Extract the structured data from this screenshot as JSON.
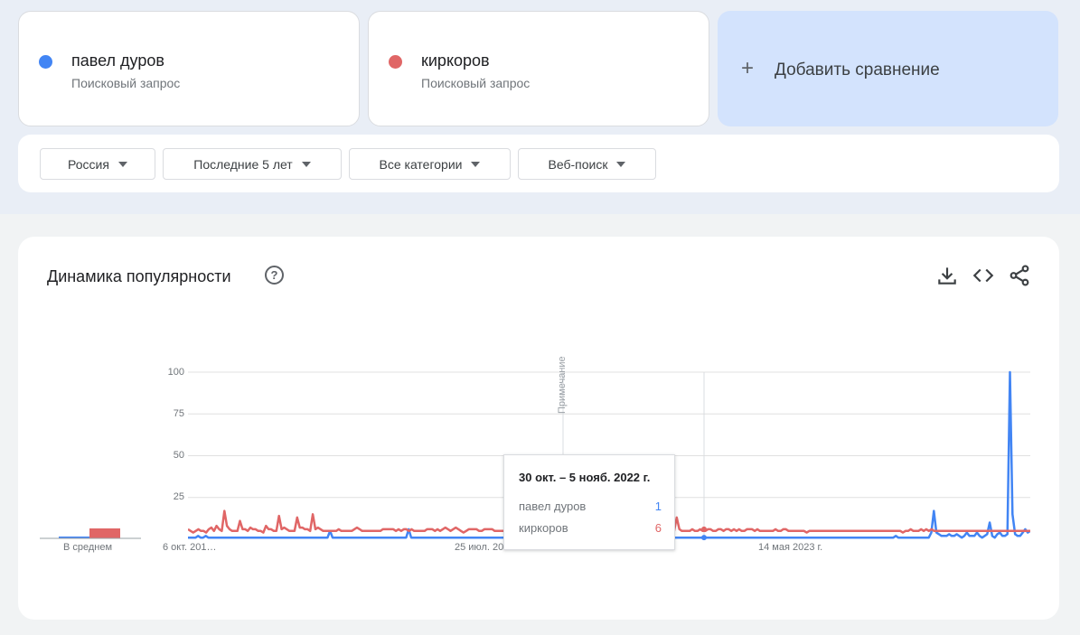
{
  "terms": [
    {
      "name": "павел дуров",
      "subtitle": "Поисковый запрос",
      "color": "#4285f4"
    },
    {
      "name": "киркоров",
      "subtitle": "Поисковый запрос",
      "color": "#e06666"
    }
  ],
  "add_comparison": {
    "icon": "plus-icon",
    "label": "Добавить сравнение"
  },
  "filters": [
    {
      "label": "Россия"
    },
    {
      "label": "Последние 5 лет"
    },
    {
      "label": "Все категории"
    },
    {
      "label": "Веб-поиск"
    }
  ],
  "chart_section": {
    "title": "Динамика популярности",
    "icons": [
      "help-icon",
      "download-icon",
      "embed-code-icon",
      "share-icon"
    ]
  },
  "chart_data": {
    "type": "line",
    "y_ticks": [
      "100",
      "75",
      "50",
      "25"
    ],
    "ylim": [
      0,
      100
    ],
    "grid": true,
    "x_tick_labels": [
      "6 окт. 201…",
      "25 июл. 2021 г.",
      "14 мая 2023 г."
    ],
    "average_label": "В среднем",
    "average": {
      "павел дуров": 1,
      "киркоров": 6
    },
    "annotation": "Примечание",
    "series": [
      {
        "name": "павел дуров",
        "color": "#4285f4",
        "values": [
          1,
          1,
          1,
          1,
          2,
          1,
          1,
          2,
          1,
          1,
          1,
          1,
          1,
          1,
          1,
          1,
          1,
          1,
          1,
          1,
          1,
          1,
          1,
          1,
          1,
          1,
          1,
          1,
          1,
          1,
          1,
          1,
          1,
          1,
          1,
          1,
          1,
          1,
          1,
          1,
          1,
          1,
          1,
          1,
          1,
          1,
          1,
          1,
          1,
          1,
          1,
          1,
          1,
          1,
          1,
          1,
          5,
          1,
          1,
          1,
          1,
          1,
          1,
          1,
          1,
          1,
          1,
          1,
          1,
          1,
          1,
          1,
          1,
          1,
          1,
          1,
          1,
          1,
          1,
          1,
          1,
          1,
          1,
          1,
          1,
          1,
          1,
          6,
          1,
          1,
          1,
          1,
          1,
          1,
          1,
          1,
          1,
          1,
          1,
          1,
          1,
          1,
          1,
          1,
          1,
          1,
          1,
          1,
          1,
          1,
          1,
          1,
          1,
          1,
          1,
          1,
          1,
          1,
          1,
          1,
          1,
          1,
          1,
          1,
          1,
          1,
          1,
          1,
          1,
          1,
          1,
          1,
          1,
          1,
          1,
          1,
          1,
          1,
          1,
          1,
          1,
          1,
          1,
          1,
          1,
          1,
          1,
          1,
          1,
          1,
          1,
          1,
          1,
          1,
          1,
          1,
          1,
          1,
          1,
          1,
          1,
          1,
          1,
          1,
          1,
          1,
          1,
          1,
          1,
          1,
          1,
          1,
          1,
          1,
          1,
          1,
          1,
          1,
          1,
          1,
          1,
          1,
          1,
          1,
          1,
          1,
          1,
          1,
          1,
          1,
          1,
          1,
          1,
          1,
          1,
          1,
          1,
          1,
          1,
          1,
          1,
          1,
          1,
          1,
          1,
          1,
          1,
          1,
          1,
          1,
          1,
          1,
          1,
          1,
          1,
          1,
          1,
          1,
          1,
          1,
          1,
          1,
          1,
          1,
          1,
          1,
          1,
          1,
          1,
          1,
          1,
          1,
          1,
          1,
          1,
          1,
          1,
          1,
          1,
          1,
          1,
          1,
          1,
          1,
          1,
          1,
          1,
          1,
          1,
          1,
          1,
          1,
          1,
          1,
          1,
          1,
          1,
          1,
          1,
          1,
          1,
          1,
          1,
          1,
          1,
          1,
          1,
          1,
          1,
          1,
          1,
          1,
          1,
          1,
          1,
          1,
          1,
          1,
          1,
          2,
          1,
          1,
          1,
          1,
          1,
          1,
          1,
          1,
          1,
          1,
          1,
          1,
          1,
          4,
          17,
          4,
          3,
          2,
          2,
          2,
          3,
          2,
          2,
          3,
          2,
          1,
          2,
          4,
          2,
          2,
          2,
          4,
          2,
          1,
          2,
          3,
          10,
          2,
          1,
          3,
          4,
          2,
          2,
          3,
          100,
          15,
          3,
          2,
          2,
          4,
          6,
          4,
          5
        ]
      },
      {
        "name": "киркоров",
        "color": "#e06666",
        "values": [
          6,
          5,
          4,
          5,
          6,
          5,
          5,
          4,
          6,
          7,
          5,
          8,
          6,
          5,
          17,
          8,
          6,
          5,
          5,
          5,
          11,
          6,
          6,
          5,
          7,
          6,
          6,
          5,
          5,
          4,
          8,
          6,
          6,
          5,
          5,
          14,
          6,
          7,
          6,
          5,
          5,
          5,
          13,
          7,
          7,
          6,
          6,
          5,
          15,
          6,
          7,
          6,
          5,
          5,
          5,
          5,
          5,
          5,
          6,
          5,
          5,
          5,
          5,
          5,
          6,
          7,
          6,
          5,
          5,
          5,
          5,
          5,
          5,
          5,
          5,
          6,
          6,
          6,
          6,
          6,
          5,
          6,
          5,
          6,
          6,
          5,
          6,
          5,
          5,
          5,
          5,
          5,
          6,
          6,
          6,
          5,
          6,
          5,
          6,
          7,
          6,
          5,
          6,
          7,
          6,
          5,
          4,
          5,
          6,
          6,
          6,
          6,
          5,
          5,
          6,
          6,
          6,
          6,
          5,
          5,
          5,
          5,
          5,
          5,
          6,
          5,
          5,
          5,
          5,
          5,
          5,
          5,
          4,
          5,
          5,
          5,
          5,
          4,
          5,
          4,
          4,
          4,
          4,
          3,
          3,
          3,
          4,
          4,
          5,
          5,
          5,
          5,
          5,
          5,
          5,
          5,
          5,
          4,
          4,
          5,
          5,
          5,
          6,
          6,
          5,
          5,
          5,
          5,
          4,
          5,
          4,
          5,
          6,
          5,
          6,
          5,
          5,
          5,
          5,
          4,
          5,
          5,
          6,
          6,
          5,
          7,
          6,
          5,
          13,
          6,
          5,
          5,
          5,
          5,
          6,
          5,
          5,
          6,
          5,
          5,
          6,
          6,
          5,
          5,
          6,
          6,
          5,
          6,
          6,
          5,
          6,
          5,
          6,
          5,
          5,
          6,
          6,
          6,
          5,
          6,
          5,
          5,
          5,
          5,
          5,
          5,
          6,
          5,
          5,
          6,
          6,
          5,
          5,
          5,
          5,
          5,
          5,
          5,
          4,
          5,
          5,
          5,
          5,
          5,
          5,
          5,
          5,
          5,
          5,
          5,
          5,
          5,
          5,
          5,
          5,
          5,
          5,
          5,
          5,
          5,
          5,
          5,
          5,
          5,
          5,
          5,
          5,
          5,
          5,
          5,
          5,
          5,
          5,
          5,
          5,
          4,
          5,
          5,
          6,
          5,
          5,
          5,
          6,
          5,
          6,
          5,
          6,
          5,
          5,
          5,
          5,
          5,
          5,
          5,
          5,
          5,
          5,
          5,
          5,
          5,
          5,
          5,
          5,
          5,
          5,
          5,
          5,
          5,
          5,
          5,
          5,
          5,
          5,
          5,
          5,
          5,
          5,
          5,
          5,
          5,
          5,
          5,
          5,
          5,
          5
        ]
      }
    ]
  },
  "tooltip": {
    "date": "30 окт. – 5 нояб. 2022 г.",
    "rows": [
      {
        "name": "павел дуров",
        "value": "1",
        "color": "#4285f4"
      },
      {
        "name": "киркоров",
        "value": "6",
        "color": "#e06666"
      }
    ]
  }
}
